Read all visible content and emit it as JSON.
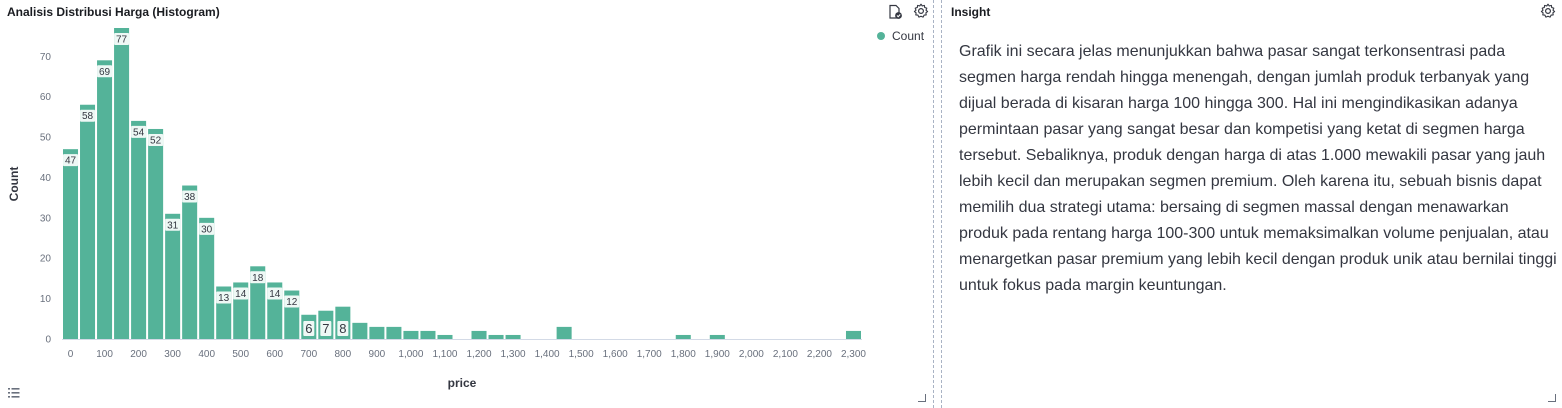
{
  "chart_panel": {
    "title": "Analisis Distribusi Harga (Histogram)"
  },
  "insight_panel": {
    "title": "Insight",
    "text": "Grafik ini secara jelas menunjukkan bahwa pasar sangat terkonsentrasi pada segmen harga rendah hingga menengah, dengan jumlah produk terbanyak yang dijual berada di kisaran harga 100 hingga 300. Hal ini mengindikasikan adanya permintaan pasar yang sangat besar dan kompetisi yang ketat di segmen harga tersebut. Sebaliknya, produk dengan harga di atas 1.000 mewakili pasar yang jauh lebih kecil dan merupakan segmen premium. Oleh karena itu, sebuah bisnis dapat memilih dua strategi utama: bersaing di segmen massal dengan menawarkan produk pada rentang harga 100-300 untuk memaksimalkan volume penjualan, atau menargetkan pasar premium yang lebih kecil dengan produk unik atau bernilai tinggi untuk fokus pada margin keuntungan."
  },
  "icons": {
    "inspect": "file-search-icon",
    "settings": "gear-icon",
    "legend_toggle": "list-icon"
  },
  "chart_data": {
    "type": "bar",
    "title": "Analisis Distribusi Harga (Histogram)",
    "xlabel": "price",
    "ylabel": "Count",
    "legend": [
      "Count"
    ],
    "legend_position": "top-right",
    "bar_color": "#54b399",
    "bin_width": 50,
    "xlim": [
      -25,
      2325
    ],
    "ylim": [
      0,
      77
    ],
    "x_ticks": [
      0,
      100,
      200,
      300,
      400,
      500,
      600,
      700,
      800,
      900,
      1000,
      1100,
      1200,
      1300,
      1400,
      1500,
      1600,
      1700,
      1800,
      1900,
      2000,
      2100,
      2200,
      2300
    ],
    "x_tick_labels": [
      "0",
      "100",
      "200",
      "300",
      "400",
      "500",
      "600",
      "700",
      "800",
      "900",
      "1,000",
      "1,100",
      "1,200",
      "1,300",
      "1,400",
      "1,500",
      "1,600",
      "1,700",
      "1,800",
      "1,900",
      "2,000",
      "2,100",
      "2,200",
      "2,300"
    ],
    "y_ticks": [
      0,
      10,
      20,
      30,
      40,
      50,
      60,
      70
    ],
    "bins": [
      0,
      50,
      100,
      150,
      200,
      250,
      300,
      350,
      400,
      450,
      500,
      550,
      600,
      650,
      700,
      750,
      800,
      850,
      900,
      950,
      1000,
      1050,
      1100,
      1200,
      1250,
      1300,
      1450,
      1800,
      1900,
      2300
    ],
    "values": [
      47,
      58,
      69,
      77,
      54,
      52,
      31,
      38,
      30,
      13,
      14,
      18,
      14,
      12,
      6,
      7,
      8,
      4,
      3,
      3,
      2,
      2,
      1,
      2,
      1,
      1,
      3,
      1,
      1,
      2
    ],
    "data_labels": [
      "47",
      "58",
      "69",
      "77",
      "54",
      "52",
      "31",
      "38",
      "30",
      "13",
      "14",
      "18",
      "14",
      "12",
      "6",
      "7",
      "8",
      "",
      "",
      "",
      "",
      "",
      "",
      "",
      "",
      "",
      "",
      "",
      "",
      ""
    ]
  }
}
